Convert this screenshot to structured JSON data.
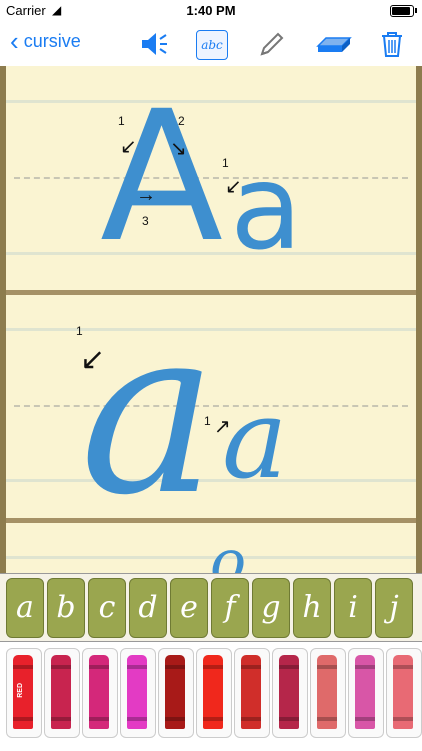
{
  "status_bar": {
    "carrier": "Carrier",
    "time": "1:40 PM"
  },
  "nav": {
    "back_label": "cursive",
    "abc_label": "abc"
  },
  "worksheet": {
    "print_upper": "A",
    "print_lower": "a",
    "cursive_upper": "a",
    "cursive_lower": "a",
    "stroke_numbers": [
      "1",
      "2",
      "3",
      "1",
      "1",
      "1"
    ]
  },
  "letter_bar": {
    "letters": [
      "a",
      "b",
      "c",
      "d",
      "e",
      "f",
      "g",
      "h",
      "i",
      "j"
    ]
  },
  "crayons": {
    "first_label": "RED",
    "colors": [
      "#e8212b",
      "#c8244f",
      "#d4287a",
      "#e33bc4",
      "#a81a18",
      "#f0281c",
      "#d02e2a",
      "#b5264a",
      "#df6a6a",
      "#d856a7",
      "#e86a74"
    ]
  }
}
